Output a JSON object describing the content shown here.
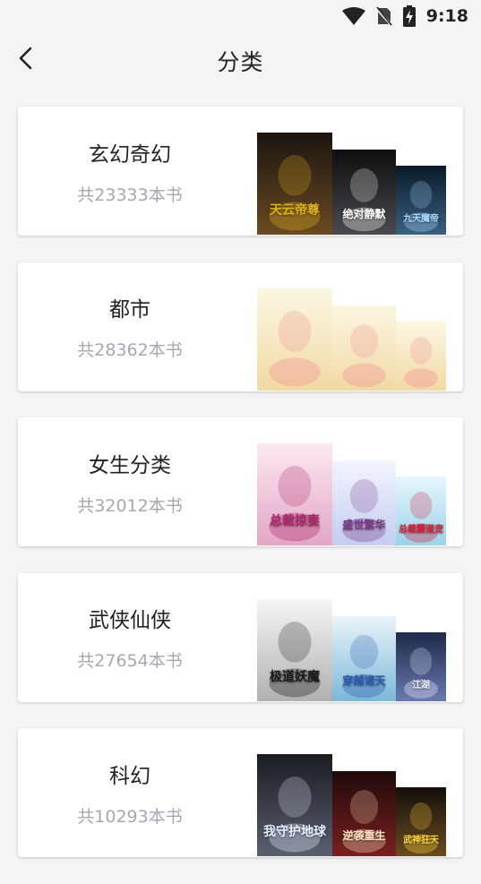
{
  "status": {
    "time": "9:18"
  },
  "header": {
    "title": "分类"
  },
  "categories": [
    {
      "name": "玄幻奇幻",
      "count": "共23333本书",
      "covers": [
        {
          "title": "天云帝尊",
          "colors": [
            "#1a1410",
            "#6b4a22",
            "#e0b020"
          ]
        },
        {
          "title": "绝对静默",
          "colors": [
            "#0e0e10",
            "#4a4a50",
            "#ffffff"
          ]
        },
        {
          "title": "九天魔帝",
          "colors": [
            "#0a1a2a",
            "#3a6080",
            "#a8d8ff"
          ]
        }
      ]
    },
    {
      "name": "都市",
      "count": "共28362本书",
      "covers": [
        {
          "title": "",
          "colors": [
            "#fbf7e2",
            "#f2d9a4",
            "#f08a92"
          ]
        },
        {
          "title": "",
          "colors": [
            "#fbf7e2",
            "#f2d9a4",
            "#f08a92"
          ]
        },
        {
          "title": "",
          "colors": [
            "#fbf7e2",
            "#f2d9a4",
            "#f08a92"
          ]
        }
      ]
    },
    {
      "name": "女生分类",
      "count": "共32012本书",
      "covers": [
        {
          "title": "总裁掠妻",
          "colors": [
            "#fde8f2",
            "#e2a6c4",
            "#b0246a"
          ]
        },
        {
          "title": "盛世繁华",
          "colors": [
            "#f2f4ff",
            "#c4cdf0",
            "#7a3a8a"
          ]
        },
        {
          "title": "总裁霸道宠",
          "colors": [
            "#e6f6ff",
            "#9cd2e8",
            "#d2203c"
          ]
        }
      ]
    },
    {
      "name": "武侠仙侠",
      "count": "共27654本书",
      "covers": [
        {
          "title": "极道妖魔",
          "colors": [
            "#f6f6f6",
            "#b0b0b0",
            "#1a1a1a"
          ]
        },
        {
          "title": "穿越诸天",
          "colors": [
            "#eaf4fa",
            "#7bb8d8",
            "#2a5ab0"
          ]
        },
        {
          "title": "江湖",
          "colors": [
            "#1e2a4a",
            "#6a7ab0",
            "#f0f0ff"
          ]
        }
      ]
    },
    {
      "name": "科幻",
      "count": "共10293本书",
      "covers": [
        {
          "title": "我守护地球",
          "colors": [
            "#1a1c22",
            "#5a6070",
            "#e8f0ff"
          ]
        },
        {
          "title": "逆袭重生",
          "colors": [
            "#200a0a",
            "#7a2020",
            "#ffe0c0"
          ]
        },
        {
          "title": "武神狂天",
          "colors": [
            "#14100a",
            "#6a4a20",
            "#ffd040"
          ]
        }
      ]
    }
  ]
}
